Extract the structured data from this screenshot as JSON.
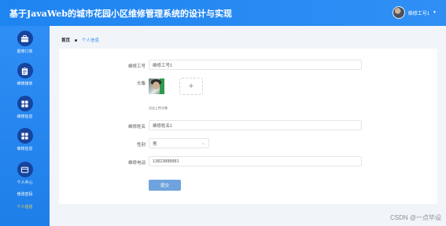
{
  "header": {
    "title": "基于JavaWeb的城市花园小区维修管理系统的设计与实现",
    "user_name": "维修工号1",
    "user_caret": "▼"
  },
  "sidebar": {
    "items": [
      {
        "label": "报修订单",
        "icon": "briefcase-icon"
      },
      {
        "label": "维修接单",
        "icon": "clipboard-icon"
      },
      {
        "label": "维修信息",
        "icon": "grid-icon"
      },
      {
        "label": "审核信息",
        "icon": "grid-icon"
      },
      {
        "label": "个人中心",
        "icon": "card-icon"
      }
    ],
    "subitems": [
      {
        "label": "修改密码",
        "active": false
      },
      {
        "label": "个人信息",
        "active": true
      }
    ]
  },
  "breadcrumb": {
    "home": "首页",
    "current": "个人信息"
  },
  "form": {
    "worker_id_label": "维修工号",
    "worker_id_value": "维修工号1",
    "avatar_label": "头像",
    "upload_plus": "+",
    "upload_hint": "点击上传头像",
    "worker_name_label": "维修姓名",
    "worker_name_value": "维修姓名1",
    "gender_label": "性别",
    "gender_value": "男",
    "gender_arrow": "⌄",
    "phone_label": "维修电话",
    "phone_value": "13823888881",
    "submit_label": "提交"
  },
  "watermark": "CSDN @一点毕设",
  "colors": {
    "primary": "#2f8ff5",
    "sidebar_icon_bg": "#16449f",
    "active_subitem": "#f5d547",
    "submit_bg": "#6fa3dd"
  }
}
